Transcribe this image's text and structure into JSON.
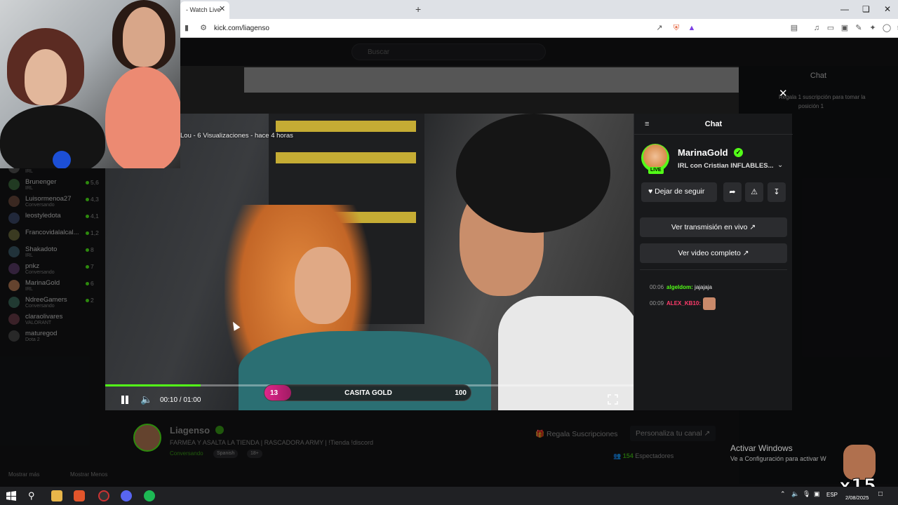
{
  "browser": {
    "tab_title": "- Watch Live",
    "url": "kick.com/liagenso"
  },
  "search": {
    "placeholder": "Buscar"
  },
  "sidebar": {
    "items": [
      {
        "name": "",
        "sub": "IRL",
        "count": ""
      },
      {
        "name": "Brunenger",
        "sub": "IRL",
        "count": "5,6"
      },
      {
        "name": "Luisormenoa27",
        "sub": "Conversando",
        "count": "4,3"
      },
      {
        "name": "leostyledota",
        "sub": "",
        "count": "4,1"
      },
      {
        "name": "Francovidalalcal...",
        "sub": "",
        "count": "1,2"
      },
      {
        "name": "Shakadoto",
        "sub": "IRL",
        "count": "8"
      },
      {
        "name": "pnkz",
        "sub": "Conversando",
        "count": "7"
      },
      {
        "name": "MarinaGold",
        "sub": "IRL",
        "count": "6"
      },
      {
        "name": "NdreeGamers",
        "sub": "Conversando",
        "count": "2"
      },
      {
        "name": "claraolivares",
        "sub": "VALORANT",
        "count": ""
      },
      {
        "name": "maturegod",
        "sub": "Dota 2",
        "count": ""
      }
    ],
    "more_label": "Mostrar más",
    "less_label": "Mostrar Menos"
  },
  "video": {
    "caption": "Lou - 6 Visualizaciones - hace 4 horas",
    "time": "00:10 / 01:00",
    "progress": 0.18,
    "goal": {
      "current": "13",
      "title": "CASITA GOLD",
      "target": "100",
      "fraction": 0.13
    }
  },
  "chat": {
    "title": "Chat",
    "channel_name": "MarinaGold",
    "live_label": "LIVE",
    "subtitle": "IRL con Cristian INFLABLES...",
    "follow_label": "Dejar de seguir",
    "btn_live": "Ver transmisión en vivo",
    "btn_full": "Ver video completo",
    "messages": [
      {
        "ts": "00:06",
        "user": "algeldom:",
        "text": "jajajaja"
      },
      {
        "ts": "00:09",
        "user": "ALEX_KB10:",
        "text": ""
      }
    ]
  },
  "bg_chat": {
    "title": "Chat",
    "sub_text_1": "Regala 1 suscripción para tomar la",
    "sub_text_2": "posición 1"
  },
  "channel": {
    "name": "Liagenso",
    "title": "FARMEA Y ASALTA LA TIENDA | RASCADORA ARMY | !Tienda !discord",
    "category": "Conversando",
    "tags": [
      "Spanish",
      "18+"
    ],
    "gift_label": "Regala Suscripciones",
    "custom_label": "Personaliza tu canal",
    "viewers": "154",
    "viewers_label": "Espectadores"
  },
  "windows": {
    "activate_title": "Activar Windows",
    "activate_sub": "Ve a Configuración para activar W",
    "lang": "ESP",
    "date": "2/08/2025",
    "overlay_badge": "x15"
  },
  "colors": {
    "accent": "#53fc18",
    "goal": "#e0268b"
  }
}
